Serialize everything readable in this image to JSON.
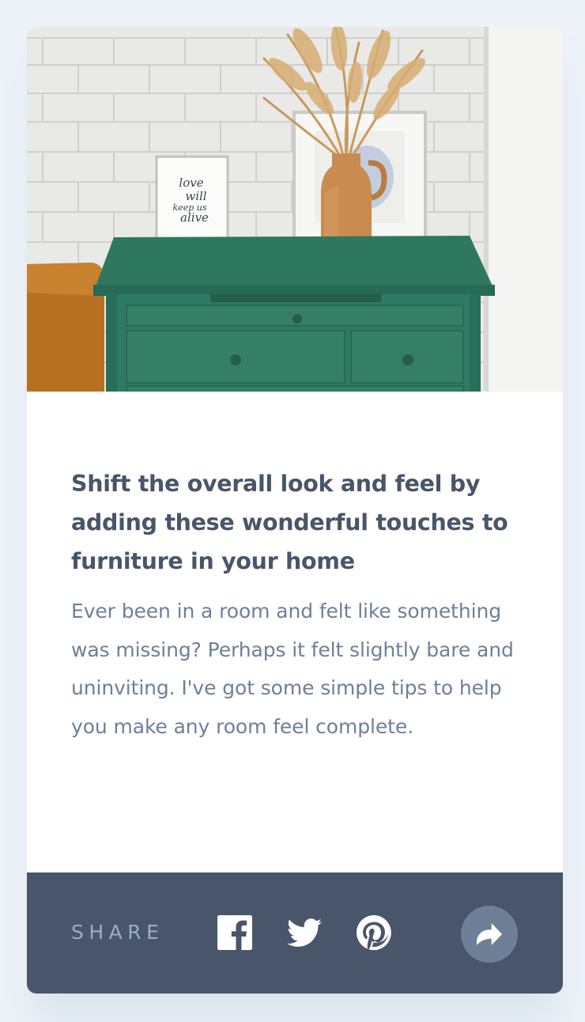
{
  "article": {
    "image_alt": "drawers",
    "title": "Shift the overall look and feel by adding these wonderful touches to furniture in your home",
    "excerpt": "Ever been in a room and felt like something was missing? Perhaps it felt slightly bare and uninviting. I've got some simple tips to help you make any room feel complete.",
    "frame_text": [
      "love",
      "will",
      "keep us",
      "alive"
    ]
  },
  "share_bar": {
    "label": "SHARE",
    "icons": [
      "facebook-icon",
      "twitter-icon",
      "pinterest-icon",
      "share-arrow-icon"
    ]
  },
  "colors": {
    "page_background": "#ECF2F8",
    "dark_blue": "#48556A",
    "desaturated_blue": "#6E8098",
    "grayish_blue": "#9DAEC2",
    "cabinet_green": "#2E7860"
  }
}
